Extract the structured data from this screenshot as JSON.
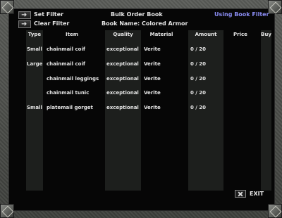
{
  "toolbar": {
    "set_filter": "Set Filter",
    "clear_filter": "Clear Filter",
    "title": "Bulk Order Book",
    "book_name": "Book Name: Colored Armor",
    "filter_status": "Using Book Filter"
  },
  "columns": [
    "Type",
    "Item",
    "Quality",
    "Material",
    "Amount",
    "Price",
    "Buy"
  ],
  "rows": [
    {
      "type": "Small",
      "item": "chainmail coif",
      "quality": "exceptional",
      "material": "Verite",
      "amount": "0 / 20"
    },
    {
      "type": "Large",
      "item": "chainmail coif",
      "quality": "exceptional",
      "material": "Verite",
      "amount": "0 / 20"
    },
    {
      "type": "",
      "item": "chainmail leggings",
      "quality": "exceptional",
      "material": "Verite",
      "amount": "0 / 20"
    },
    {
      "type": "",
      "item": "chainmail tunic",
      "quality": "exceptional",
      "material": "Verite",
      "amount": "0 / 20"
    },
    {
      "type": "Small",
      "item": "platemail gorget",
      "quality": "exceptional",
      "material": "Verite",
      "amount": "0 / 20"
    }
  ],
  "exit_label": "EXIT",
  "colors": {
    "filter_status": "#8a8cf2",
    "column_bg": "#1d1f1d"
  },
  "icons": {
    "set_filter": "arrow-icon",
    "clear_filter": "arrow-icon",
    "exit": "x-icon"
  }
}
